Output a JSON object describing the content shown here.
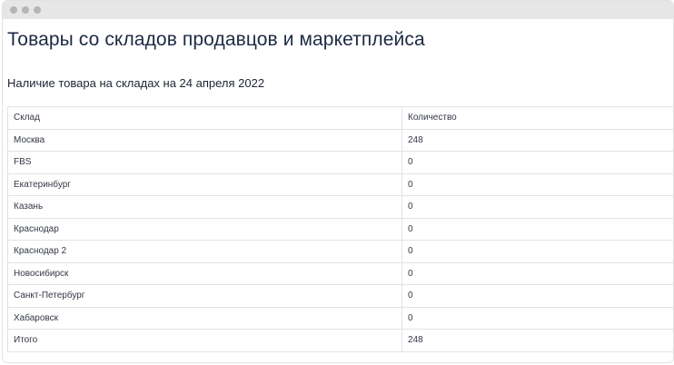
{
  "page": {
    "title": "Товары со складов продавцов и маркетплейса",
    "subtitle": "Наличие товара на складах на 24 апреля 2022"
  },
  "table": {
    "headers": [
      "Склад",
      "Количество"
    ],
    "rows": [
      [
        "Москва",
        "248"
      ],
      [
        "FBS",
        "0"
      ],
      [
        "Екатеринбург",
        "0"
      ],
      [
        "Казань",
        "0"
      ],
      [
        "Краснодар",
        "0"
      ],
      [
        "Краснодар 2",
        "0"
      ],
      [
        "Новосибирск",
        "0"
      ],
      [
        "Санкт-Петербург",
        "0"
      ],
      [
        "Хабаровск",
        "0"
      ],
      [
        "Итого",
        "248"
      ]
    ]
  }
}
